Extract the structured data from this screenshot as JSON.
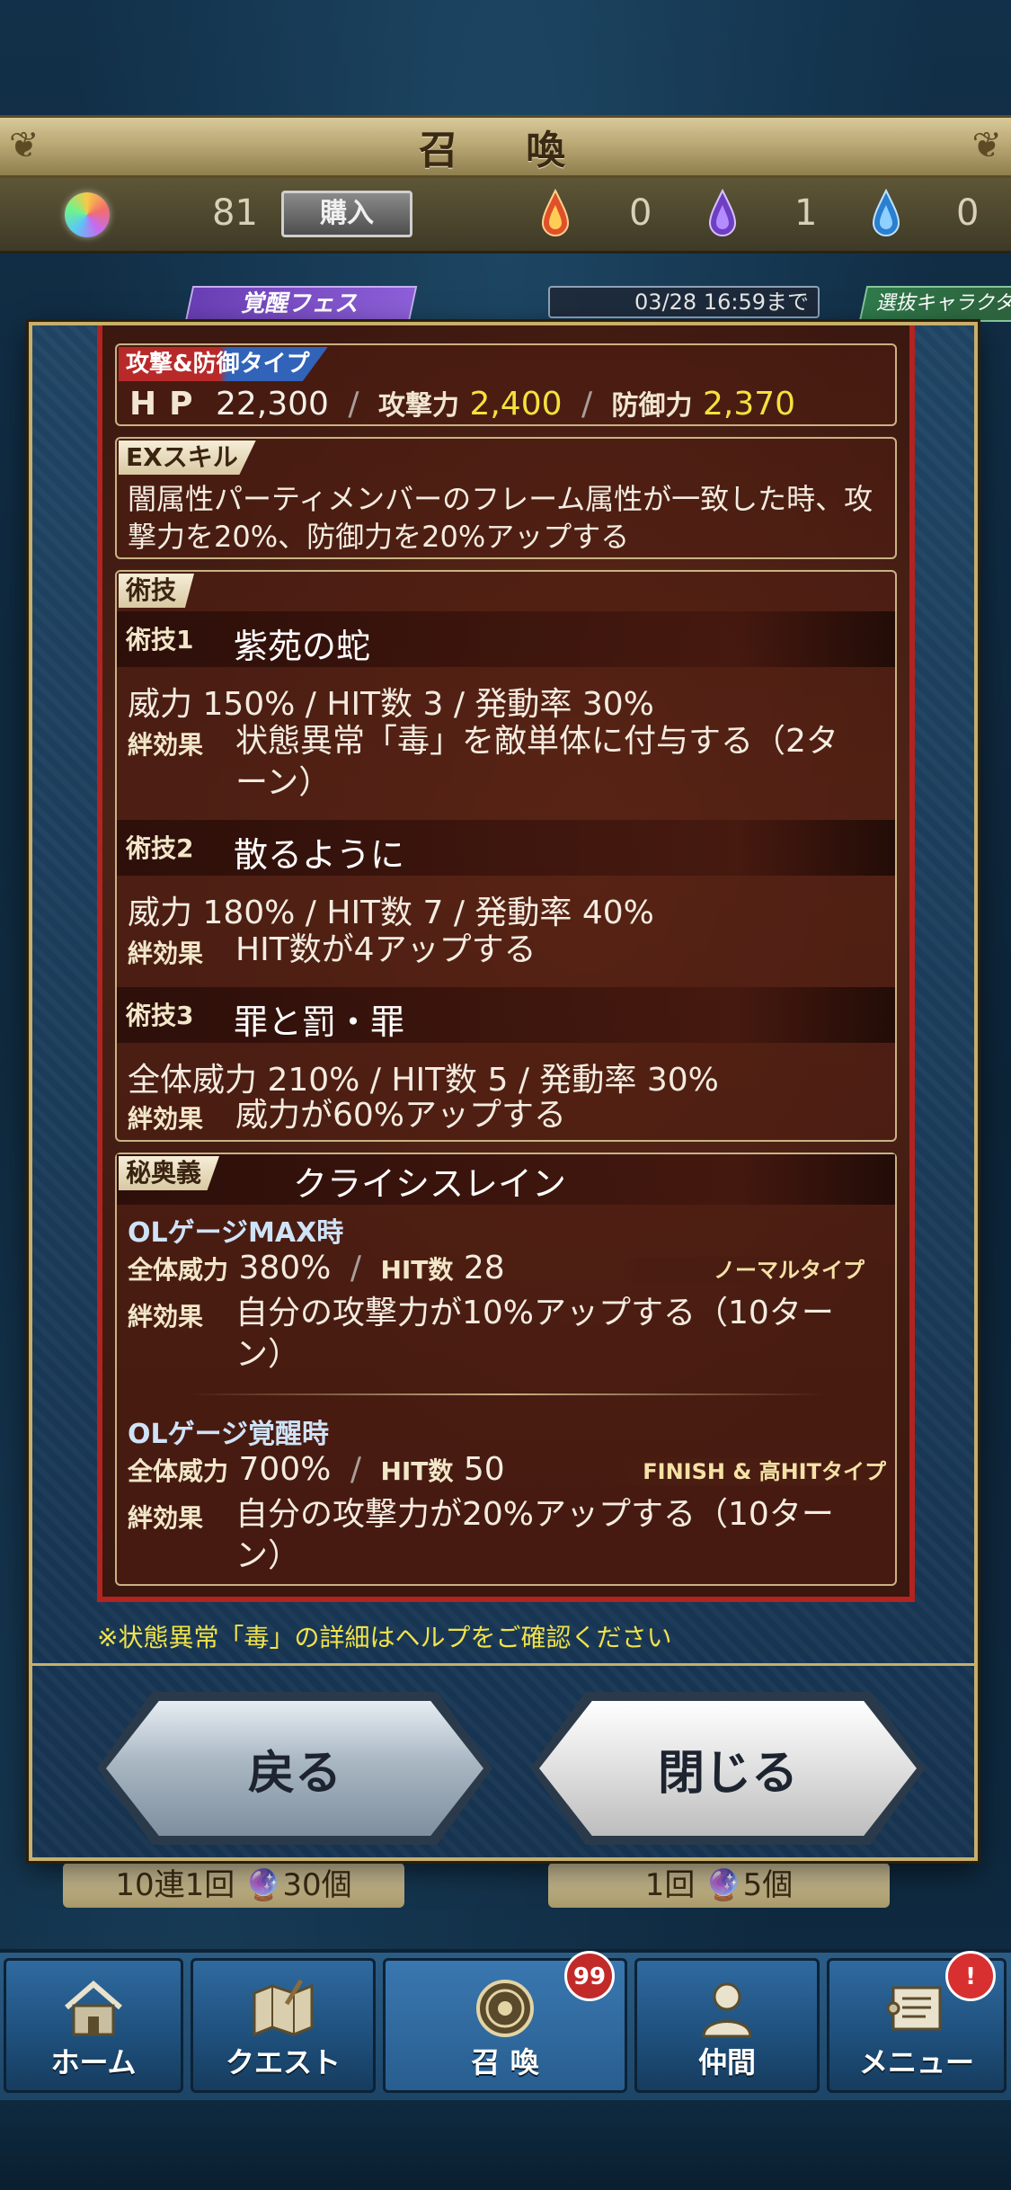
{
  "header": {
    "title": "召 喚",
    "gem_count": "81",
    "buy_label": "購入",
    "red_drop_count": "0",
    "purple_drop_count": "1",
    "blue_drop_count": "0"
  },
  "banner": {
    "fes_label": "覚醒フェス",
    "deadline": "03/28 16:59まで",
    "select_label": "選抜キャラクタ"
  },
  "unit": {
    "type_label": "攻撃&防御タイプ",
    "hp_label": "HP",
    "hp_value": "22,300",
    "atk_label": "攻撃力",
    "atk_value": "2,400",
    "def_label": "防御力",
    "def_value": "2,370",
    "ex_label": "EXスキル",
    "ex_text": "闇属性パーティメンバーのフレーム属性が一致した時、攻撃力を20%、防御力を20%アップする",
    "skills_label": "術技",
    "kizuna_label": "絆効果",
    "skills": [
      {
        "tag": "術技1",
        "name": "紫苑の蛇",
        "stats": "威力 150% / HIT数 3 / 発動率 30%",
        "kizuna": "状態異常「毒」を敵単体に付与する（2ターン）"
      },
      {
        "tag": "術技2",
        "name": "散るように",
        "stats": "威力 180% / HIT数 7 / 発動率 40%",
        "kizuna": "HIT数が4アップする"
      },
      {
        "tag": "術技3",
        "name": "罪と罰・罪",
        "stats": "全体威力 210% / HIT数 5 / 発動率 30%",
        "kizuna": "威力が60%アップする"
      }
    ],
    "mystic": {
      "label": "秘奥義",
      "name": "クライシスレイン",
      "max_head": "OLゲージMAX時",
      "max_power_label": "全体威力",
      "max_power": "380%",
      "max_hit_label": "HIT数",
      "max_hit": "28",
      "max_type": "ノーマルタイプ",
      "max_kizuna": "自分の攻撃力が10%アップする（10ターン）",
      "awake_head": "OLゲージ覚醒時",
      "awake_power": "700%",
      "awake_hit": "50",
      "awake_type": "FINISH & 高HITタイプ",
      "awake_kizuna": "自分の攻撃力が20%アップする（10ターン）"
    },
    "note": "※状態異常「毒」の詳細はヘルプをご確認ください"
  },
  "buttons": {
    "back": "戻る",
    "close": "閉じる"
  },
  "summon_options": {
    "left": "10連1回 🔮30個",
    "right": "1回 🔮5個"
  },
  "nav": {
    "items": [
      {
        "label": "ホーム",
        "icon": "home-icon"
      },
      {
        "label": "クエスト",
        "icon": "quest-map-icon"
      },
      {
        "label": "召 喚",
        "icon": "summon-icon"
      },
      {
        "label": "仲間",
        "icon": "ally-icon"
      },
      {
        "label": "メニュー",
        "icon": "menu-scroll-icon"
      }
    ],
    "summon_badge": "99",
    "menu_badge": "!"
  },
  "colors": {
    "accent_gold": "#c7b06b",
    "panel_red": "#b3231f",
    "stat_yellow": "#f4e23e",
    "note_yellow": "#f0e24a"
  }
}
